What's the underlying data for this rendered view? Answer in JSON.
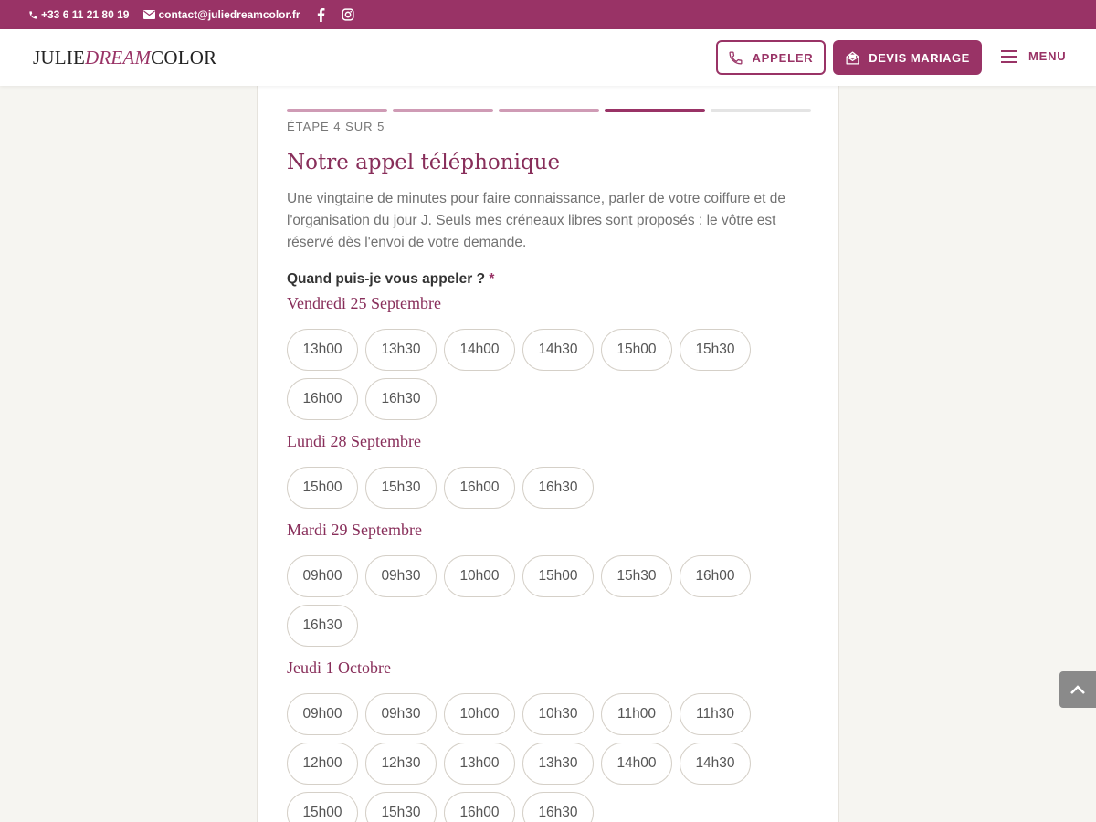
{
  "topbar": {
    "phone": "+33 6 11 21 80 19",
    "email": "contact@juliedreamcolor.fr",
    "social": [
      "facebook-icon",
      "instagram-icon"
    ]
  },
  "header": {
    "logo": {
      "part1": "JULIE",
      "part2": "DREAM",
      "part3": "COLOR"
    },
    "call_label": "APPELER",
    "devis_label": "DEVIS MARIAGE",
    "menu_label": "MENU"
  },
  "form": {
    "progress": {
      "current": 4,
      "total": 5
    },
    "step_label": "ÉTAPE 4 SUR 5",
    "title": "Notre appel téléphonique",
    "description": "Une vingtaine de minutes pour faire connaissance, parler de votre coiffure et de l'organisation du jour J. Seuls mes créneaux libres sont proposés : le vôtre est réservé dès l'envoi de votre demande.",
    "question": "Quand puis-je vous appeler ?",
    "required_mark": "*",
    "days": [
      {
        "label": "Vendredi 25 Septembre",
        "slots": [
          "13h00",
          "13h30",
          "14h00",
          "14h30",
          "15h00",
          "15h30",
          "16h00",
          "16h30"
        ]
      },
      {
        "label": "Lundi 28 Septembre",
        "slots": [
          "15h00",
          "15h30",
          "16h00",
          "16h30"
        ]
      },
      {
        "label": "Mardi 29 Septembre",
        "slots": [
          "09h00",
          "09h30",
          "10h00",
          "15h00",
          "15h30",
          "16h00",
          "16h30"
        ]
      },
      {
        "label": "Jeudi 1 Octobre",
        "slots": [
          "09h00",
          "09h30",
          "10h00",
          "10h30",
          "11h00",
          "11h30",
          "12h00",
          "12h30",
          "13h00",
          "13h30",
          "14h00",
          "14h30",
          "15h00",
          "15h30",
          "16h00",
          "16h30"
        ]
      }
    ]
  },
  "colors": {
    "brand": "#993366",
    "progress_done": "#cf9bb5",
    "progress_current": "#993366",
    "progress_todo": "#e4e4e4"
  }
}
